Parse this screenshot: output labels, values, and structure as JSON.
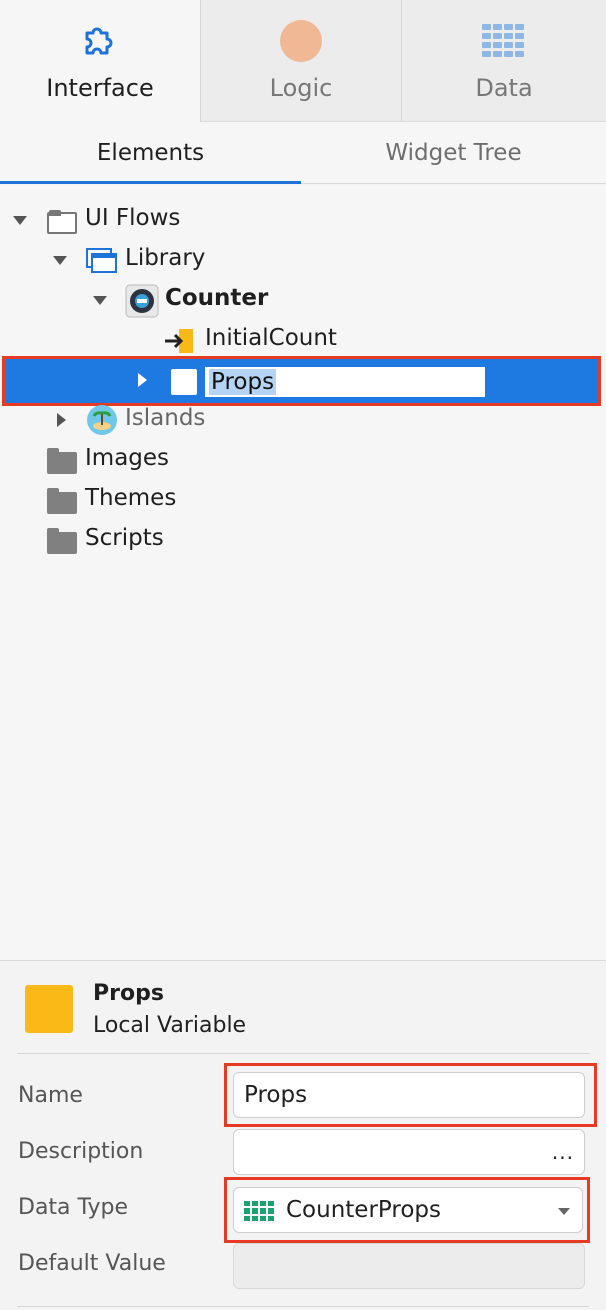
{
  "top_tabs": [
    {
      "label": "Interface",
      "icon": "puzzle-icon"
    },
    {
      "label": "Logic",
      "icon": "logic-circle-icon"
    },
    {
      "label": "Data",
      "icon": "table-grid-icon"
    }
  ],
  "sub_tabs": {
    "elements": "Elements",
    "widget_tree": "Widget Tree"
  },
  "tree": {
    "ui_flows": "UI Flows",
    "library": "Library",
    "counter": "Counter",
    "initial_count": "InitialCount",
    "props_editing": "Props",
    "islands": "Islands",
    "images": "Images",
    "themes": "Themes",
    "scripts": "Scripts"
  },
  "properties": {
    "title": "Props",
    "subtitle": "Local Variable",
    "name_label": "Name",
    "name_value": "Props",
    "description_label": "Description",
    "description_value": "",
    "description_button": "...",
    "data_type_label": "Data Type",
    "data_type_value": "CounterProps",
    "default_value_label": "Default Value",
    "default_value": ""
  },
  "colors": {
    "accent": "#1e73d8",
    "selection": "#1e7ae0",
    "highlight_box": "#e53a24",
    "local_variable": "#fbb917",
    "structure_icon": "#1aa36e"
  }
}
